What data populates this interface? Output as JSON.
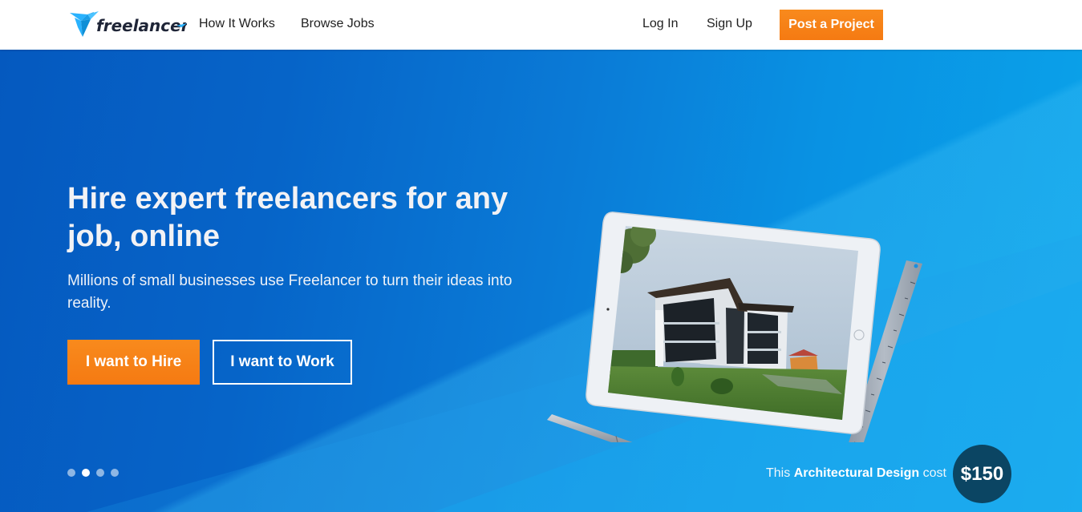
{
  "header": {
    "logo_text": "freelancer",
    "nav": {
      "how_it_works": "How It Works",
      "browse_jobs": "Browse Jobs",
      "log_in": "Log In",
      "sign_up": "Sign Up",
      "post_project": "Post a Project"
    }
  },
  "hero": {
    "title": "Hire expert freelancers for any job, online",
    "subtitle": "Millions of small businesses use Freelancer to turn their ideas into reality.",
    "hire_button": "I want to Hire",
    "work_button": "I want to Work",
    "carousel": {
      "total_slides": 4,
      "active_slide": 2
    },
    "caption": {
      "prefix": "This",
      "category": "Architectural Design",
      "suffix": "cost",
      "price": "$150"
    },
    "image_description": "Tablet showing architectural rendering of a modern house, with pen and ruler"
  },
  "colors": {
    "accent_orange": "#f7811b",
    "hero_blue": "#0664c8",
    "price_badge": "#0b4563",
    "logo_blue": "#29b2fe",
    "logo_dark": "#1f2537"
  }
}
